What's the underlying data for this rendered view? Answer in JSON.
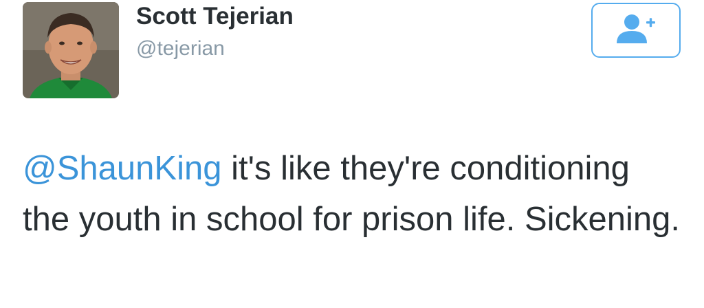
{
  "user": {
    "display_name": "Scott Tejerian",
    "handle": "@tejerian"
  },
  "follow_button": {
    "icon": "add-user-icon",
    "color": "#55acee"
  },
  "tweet": {
    "mention": "@ShaunKing",
    "text": " it's like they're conditioning the youth in school for prison life. Sickening."
  },
  "colors": {
    "name": "#292f33",
    "handle": "#8899a6",
    "link": "#3b94d9",
    "accent": "#55acee"
  }
}
